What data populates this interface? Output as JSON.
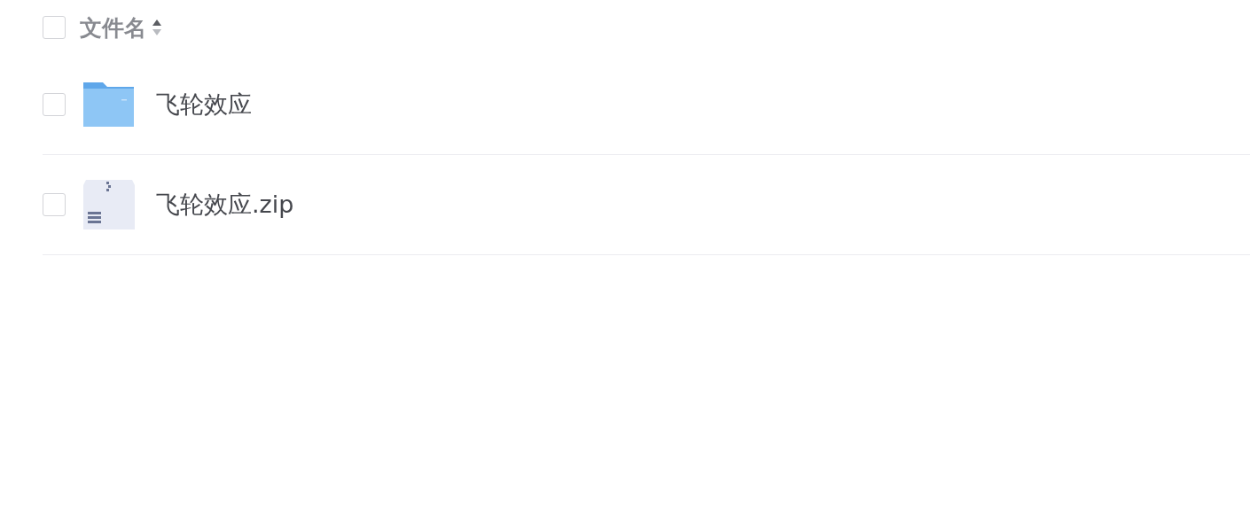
{
  "header": {
    "checked": false,
    "label": "文件名"
  },
  "files": [
    {
      "kind": "folder",
      "name": "飞轮效应",
      "checked": false
    },
    {
      "kind": "zip",
      "name": "飞轮效应.zip",
      "checked": false
    }
  ]
}
